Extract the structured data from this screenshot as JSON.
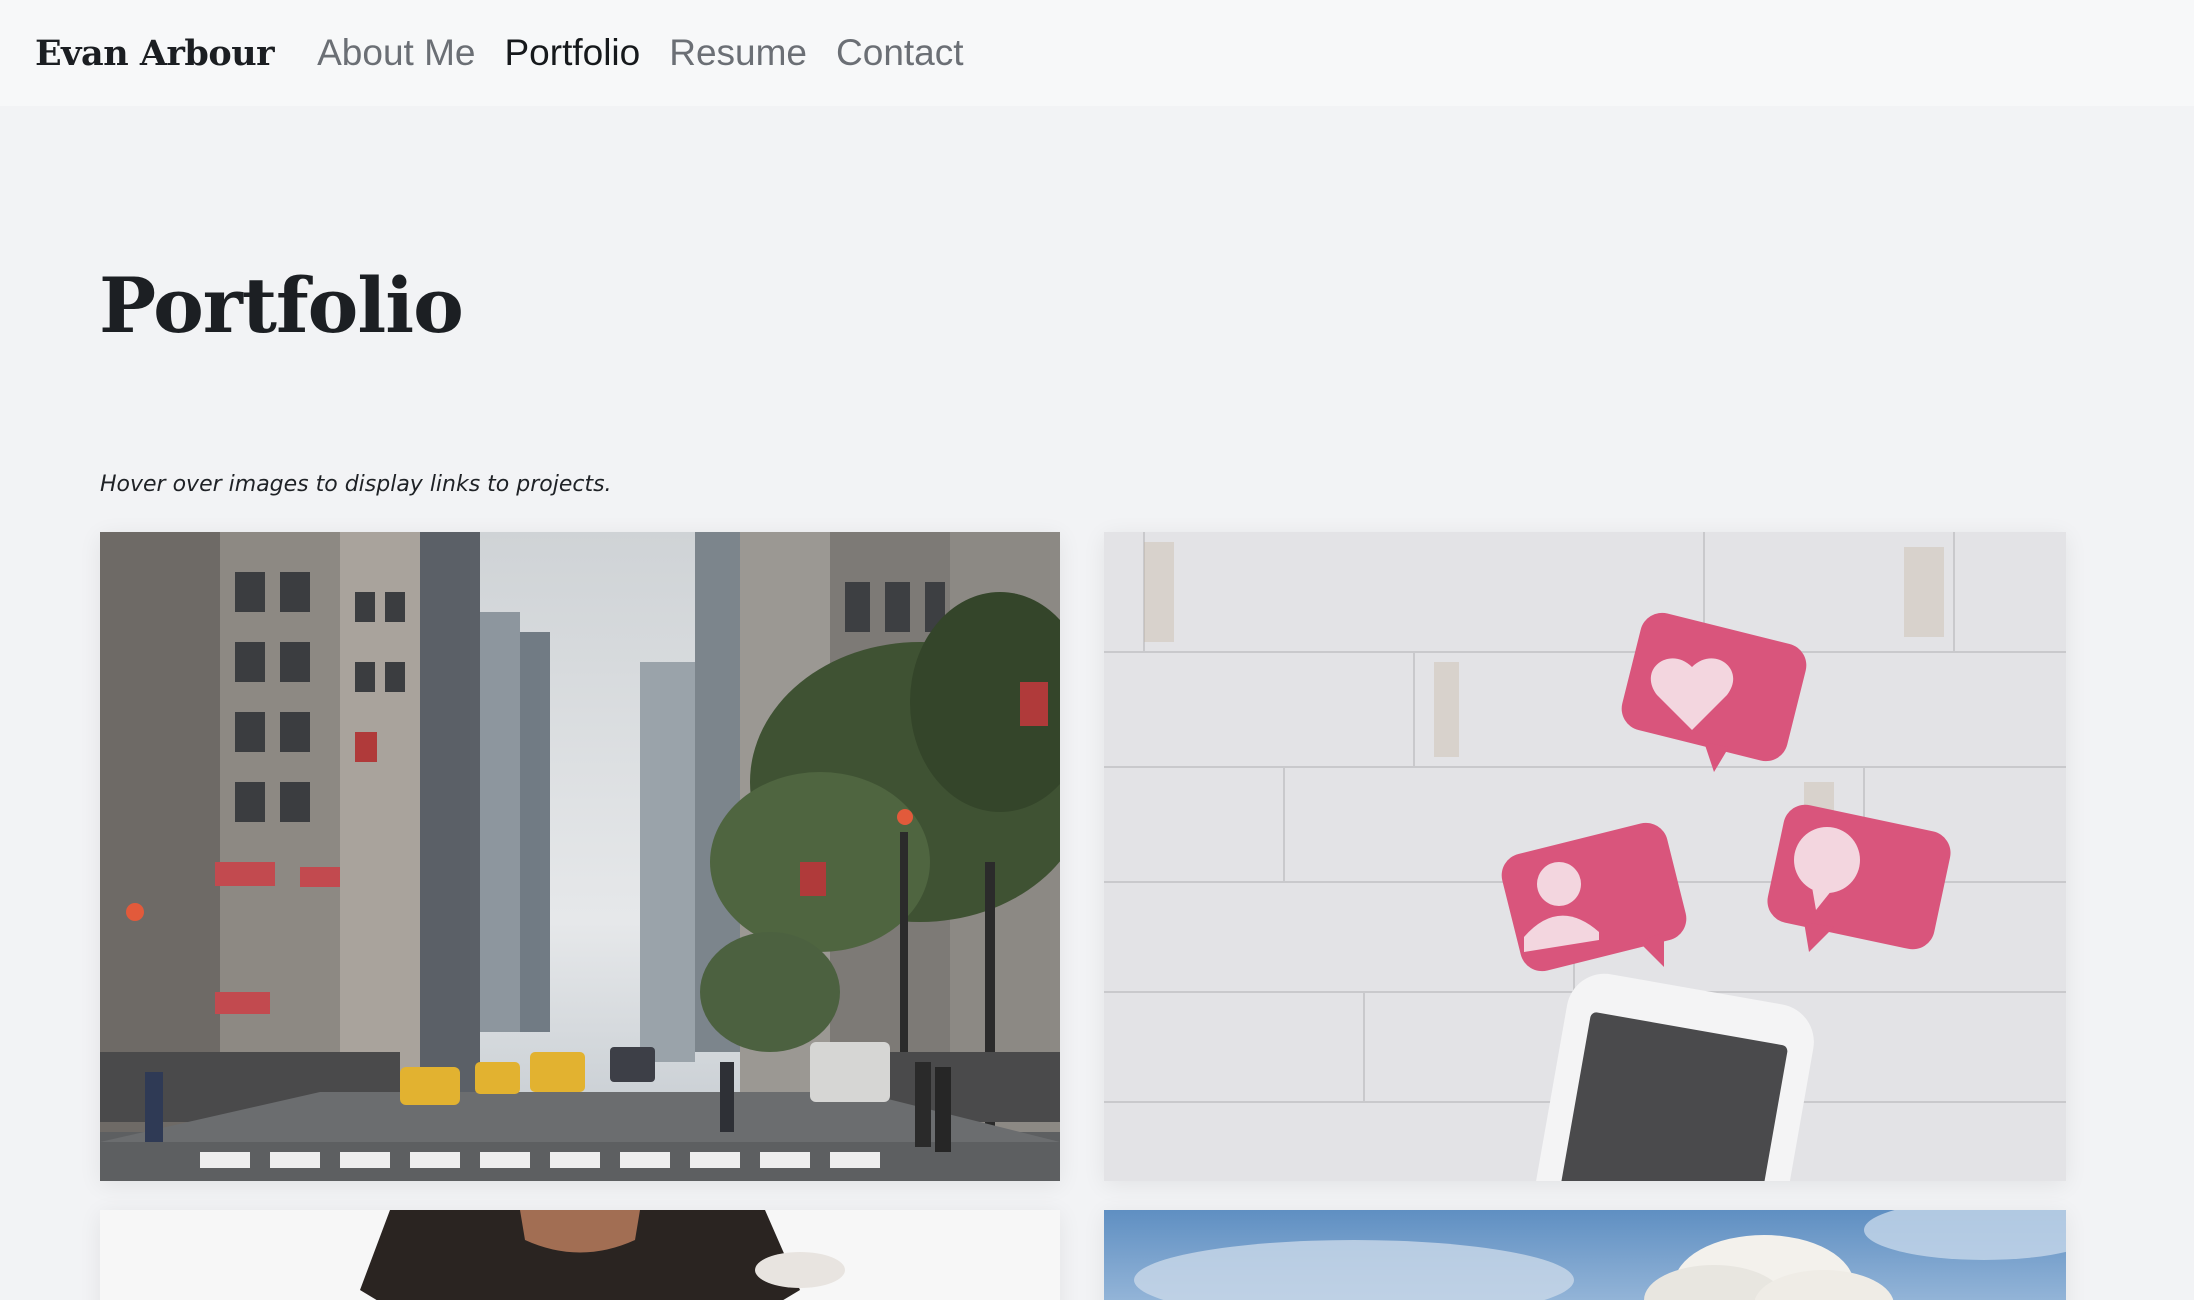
{
  "nav": {
    "brand": "Evan Arbour",
    "links": [
      {
        "label": "About Me",
        "active": false
      },
      {
        "label": "Portfolio",
        "active": true
      },
      {
        "label": "Resume",
        "active": false
      },
      {
        "label": "Contact",
        "active": false
      }
    ]
  },
  "main": {
    "title": "Portfolio",
    "hint": "Hover over images to display links to projects."
  },
  "colors": {
    "page_background": "#f2f3f5",
    "navbar_background": "#f7f8f9",
    "text_dark": "#1c1f23",
    "nav_inactive": "#6b6f75",
    "bubble_pink": "#d9557c"
  },
  "icons": {
    "heart": "heart-icon",
    "person": "user-icon",
    "comment": "comment-icon"
  }
}
